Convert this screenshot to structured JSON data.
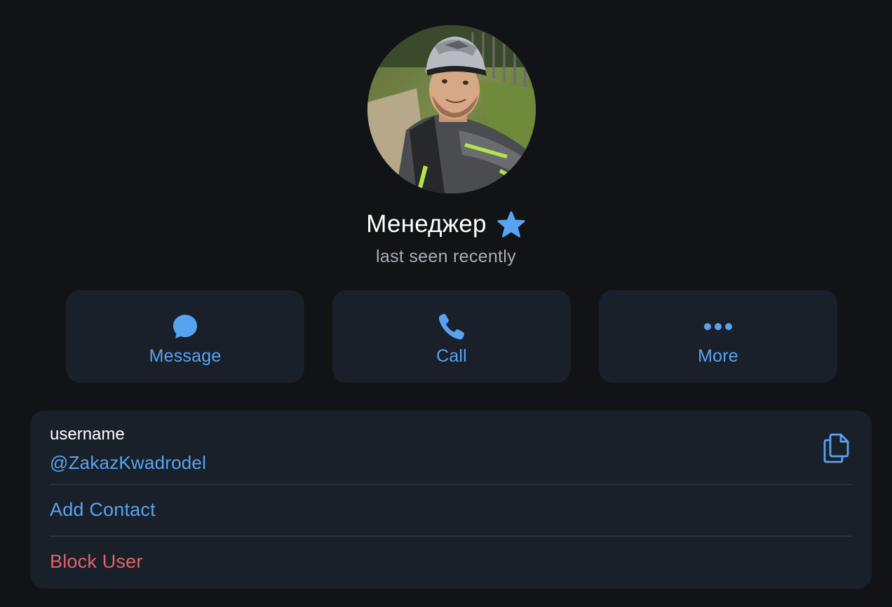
{
  "profile": {
    "name": "Менеджер",
    "badge_icon": "premium-star-icon",
    "status": "last seen recently",
    "avatar": "profile-photo"
  },
  "actions": [
    {
      "label": "Message",
      "icon": "chat-bubble-icon"
    },
    {
      "label": "Call",
      "icon": "phone-icon"
    },
    {
      "label": "More",
      "icon": "more-dots-icon"
    }
  ],
  "info": {
    "username_caption": "username",
    "username_value": "@ZakazKwadrodel",
    "copy_icon": "copy-icon",
    "add_contact": "Add Contact",
    "block_user": "Block User"
  },
  "colors": {
    "background": "#121316",
    "surface": "#1a202a",
    "accent": "#58a3f0",
    "danger": "#e26365",
    "secondary_text": "#a8aeb8"
  }
}
